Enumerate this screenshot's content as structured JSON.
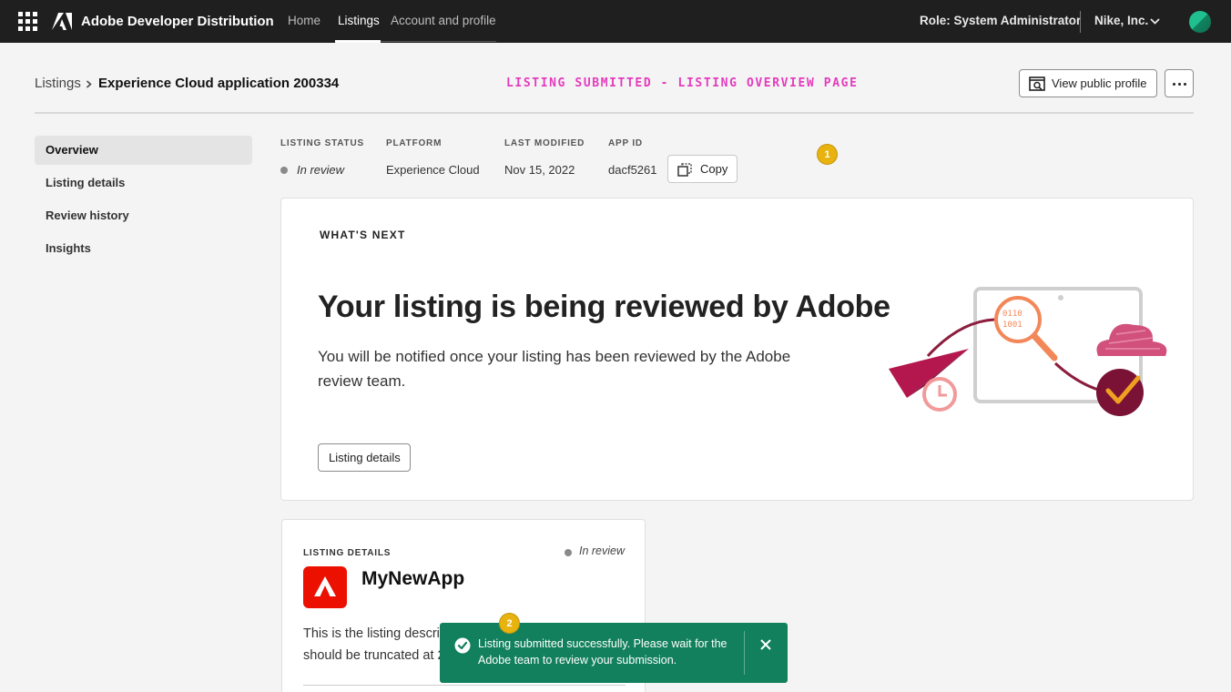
{
  "colors": {
    "topbar": "#1f1f1f",
    "accent_annotation": "#e43bbd",
    "toast": "#12805c",
    "marker": "#e8b30f",
    "app_icon": "#eb1000"
  },
  "topbar": {
    "app_name": "Adobe Developer Distribution",
    "nav": [
      {
        "label": "Home"
      },
      {
        "label": "Listings",
        "active": true
      },
      {
        "label": "Account and profile"
      }
    ],
    "role": "Role: System Administrator",
    "org": "Nike, Inc."
  },
  "header": {
    "breadcrumb_root": "Listings",
    "breadcrumb_current": "Experience Cloud application 200334",
    "annotation": "LISTING SUBMITTED - LISTING OVERVIEW PAGE",
    "view_profile": "View public profile"
  },
  "sidebar": {
    "items": [
      {
        "label": "Overview",
        "active": true
      },
      {
        "label": "Listing details"
      },
      {
        "label": "Review history"
      },
      {
        "label": "Insights"
      }
    ]
  },
  "meta": {
    "status_label": "LISTING STATUS",
    "status_value": "In review",
    "platform_label": "PLATFORM",
    "platform_value": "Experience Cloud",
    "modified_label": "LAST MODIFIED",
    "modified_value": "Nov 15, 2022",
    "appid_label": "APP ID",
    "appid_value": "dacf5261",
    "copy_label": "Copy"
  },
  "markers": {
    "one": "1",
    "two": "2"
  },
  "next": {
    "eyebrow": "WHAT'S NEXT",
    "title": "Your listing is being reviewed by Adobe",
    "description": "You will be notified once your listing has been reviewed by the Adobe review team.",
    "button": "Listing details"
  },
  "details_card": {
    "eyebrow": "LISTING DETAILS",
    "status": "In review",
    "app_name": "MyNewApp",
    "desc_line1": "This is the listing description",
    "desc_line2": "should be truncated at 2"
  },
  "toast": {
    "message": "Listing submitted successfully. Please wait for the Adobe team to review your submission."
  }
}
